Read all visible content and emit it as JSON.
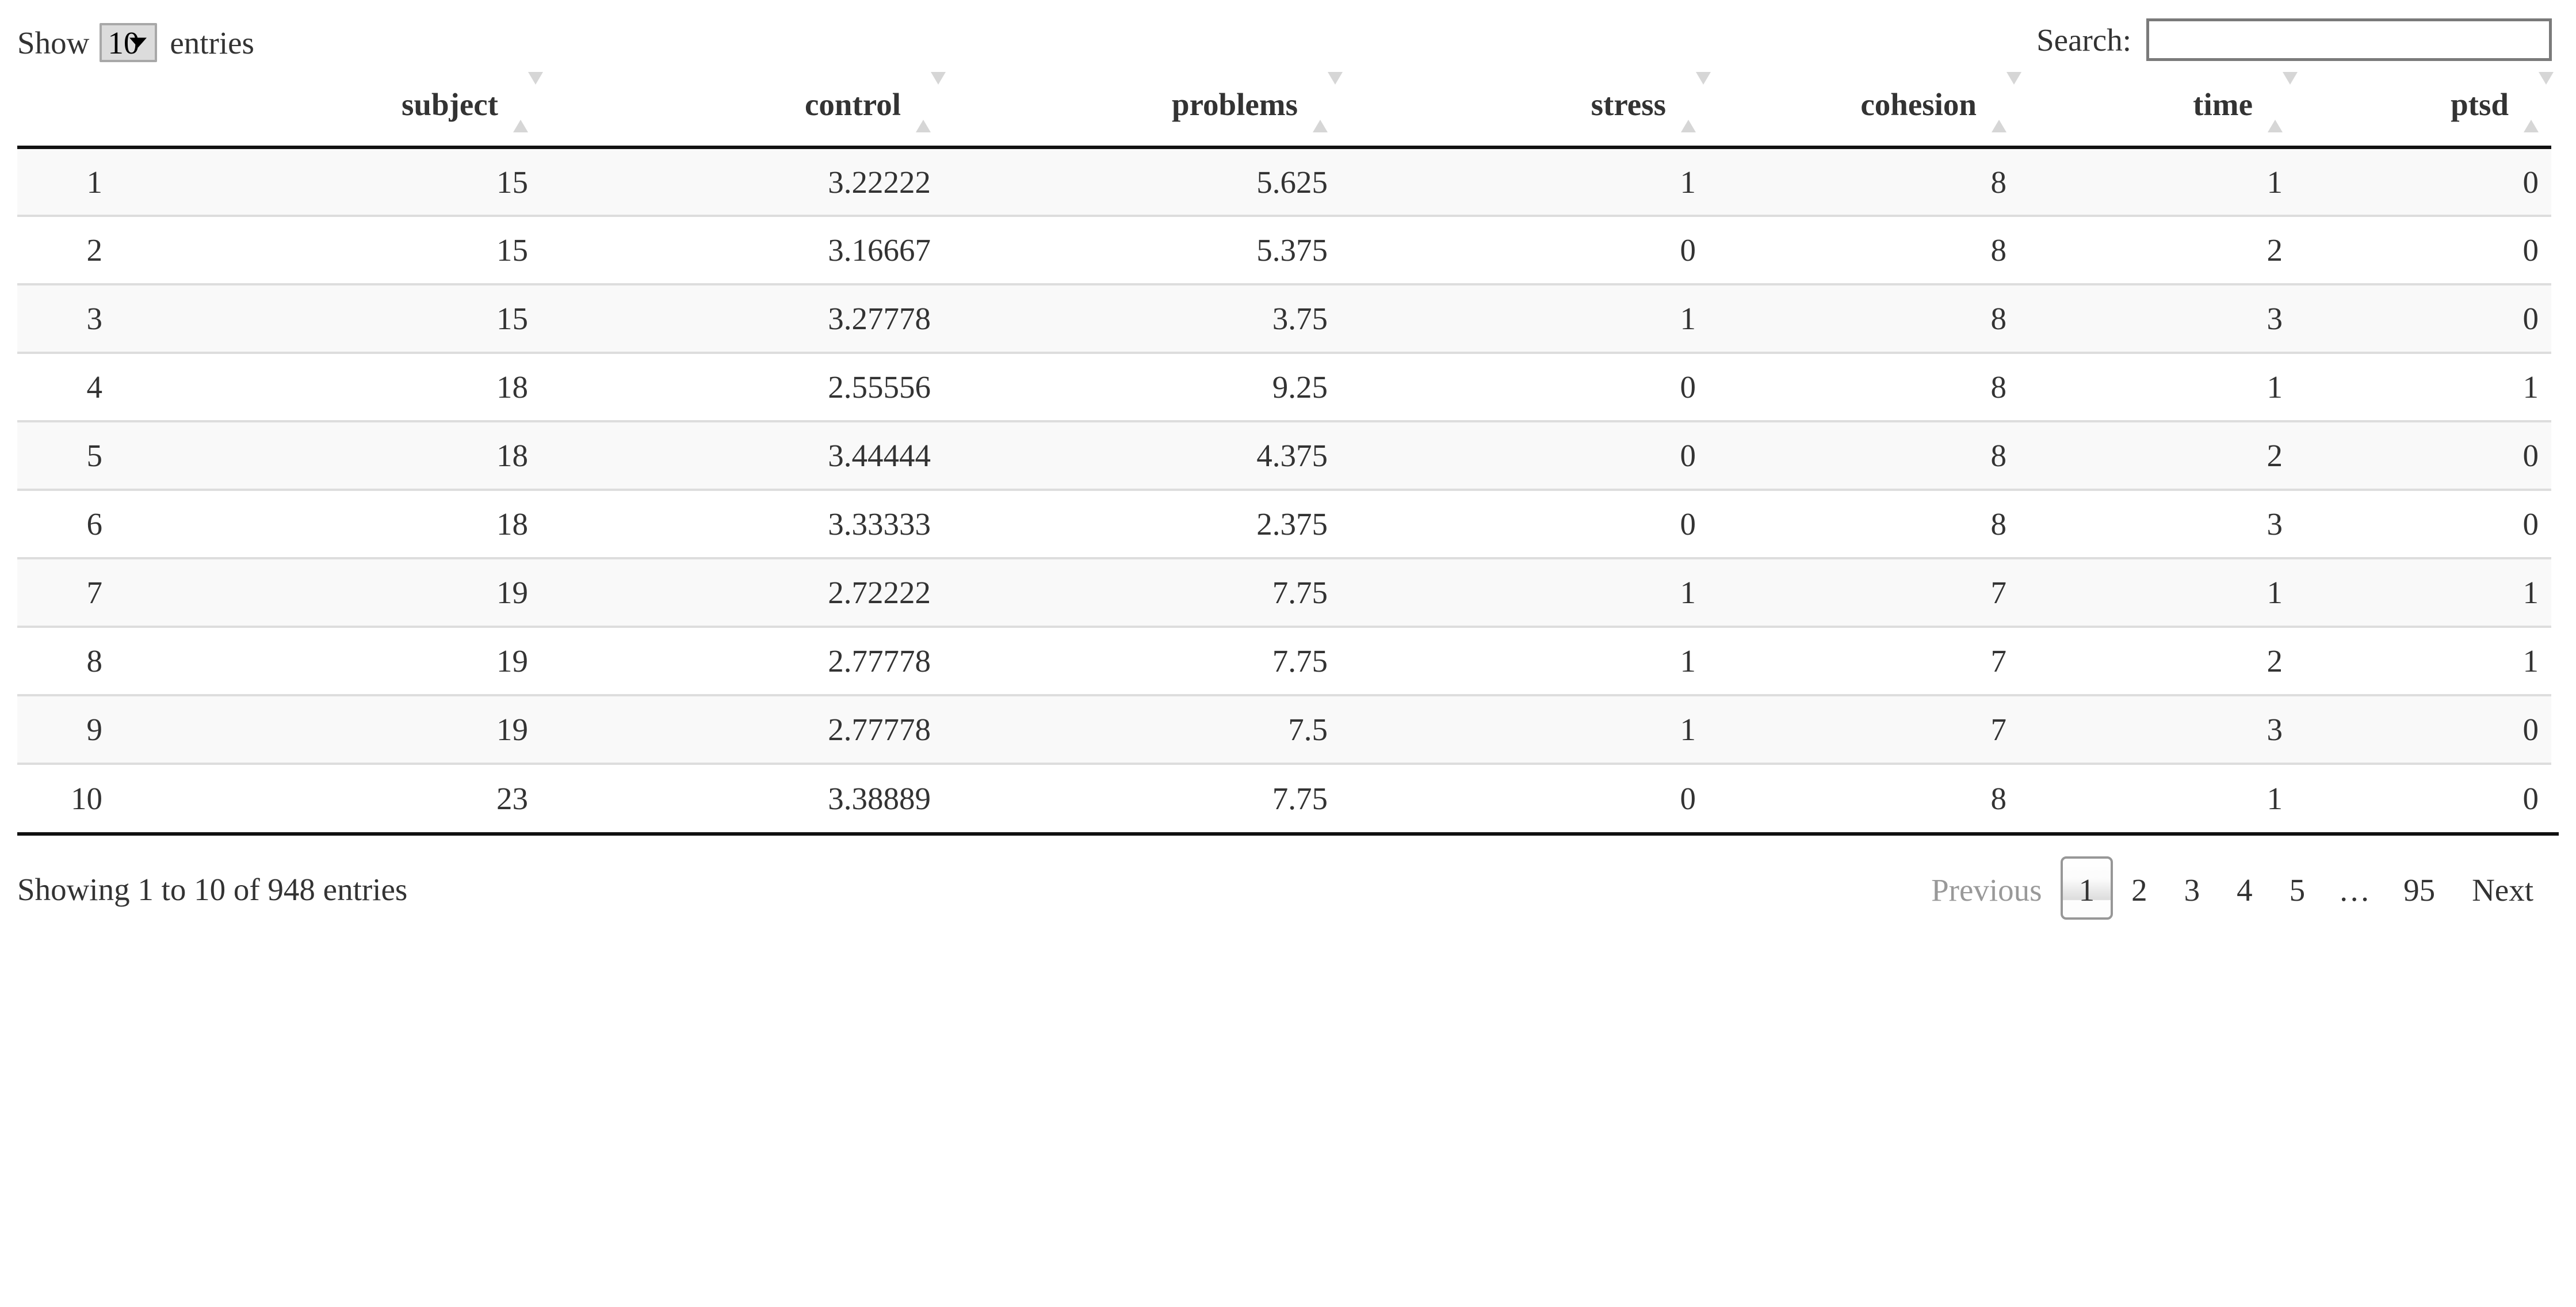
{
  "length_menu": {
    "label_before": "Show",
    "selected": "10",
    "label_after": "entries",
    "options": [
      "10",
      "25",
      "50",
      "100"
    ]
  },
  "search": {
    "label": "Search:",
    "value": "",
    "placeholder": ""
  },
  "table": {
    "columns": [
      {
        "key": "rownum",
        "label": "",
        "sortable": false
      },
      {
        "key": "subject",
        "label": "subject",
        "sortable": true
      },
      {
        "key": "control",
        "label": "control",
        "sortable": true
      },
      {
        "key": "problems",
        "label": "problems",
        "sortable": true
      },
      {
        "key": "stress",
        "label": "stress",
        "sortable": true
      },
      {
        "key": "cohesion",
        "label": "cohesion",
        "sortable": true
      },
      {
        "key": "time",
        "label": "time",
        "sortable": true
      },
      {
        "key": "ptsd",
        "label": "ptsd",
        "sortable": true
      }
    ],
    "rows": [
      {
        "rownum": "1",
        "subject": "15",
        "control": "3.22222",
        "problems": "5.625",
        "stress": "1",
        "cohesion": "8",
        "time": "1",
        "ptsd": "0"
      },
      {
        "rownum": "2",
        "subject": "15",
        "control": "3.16667",
        "problems": "5.375",
        "stress": "0",
        "cohesion": "8",
        "time": "2",
        "ptsd": "0"
      },
      {
        "rownum": "3",
        "subject": "15",
        "control": "3.27778",
        "problems": "3.75",
        "stress": "1",
        "cohesion": "8",
        "time": "3",
        "ptsd": "0"
      },
      {
        "rownum": "4",
        "subject": "18",
        "control": "2.55556",
        "problems": "9.25",
        "stress": "0",
        "cohesion": "8",
        "time": "1",
        "ptsd": "1"
      },
      {
        "rownum": "5",
        "subject": "18",
        "control": "3.44444",
        "problems": "4.375",
        "stress": "0",
        "cohesion": "8",
        "time": "2",
        "ptsd": "0"
      },
      {
        "rownum": "6",
        "subject": "18",
        "control": "3.33333",
        "problems": "2.375",
        "stress": "0",
        "cohesion": "8",
        "time": "3",
        "ptsd": "0"
      },
      {
        "rownum": "7",
        "subject": "19",
        "control": "2.72222",
        "problems": "7.75",
        "stress": "1",
        "cohesion": "7",
        "time": "1",
        "ptsd": "1"
      },
      {
        "rownum": "8",
        "subject": "19",
        "control": "2.77778",
        "problems": "7.75",
        "stress": "1",
        "cohesion": "7",
        "time": "2",
        "ptsd": "1"
      },
      {
        "rownum": "9",
        "subject": "19",
        "control": "2.77778",
        "problems": "7.5",
        "stress": "1",
        "cohesion": "7",
        "time": "3",
        "ptsd": "0"
      },
      {
        "rownum": "10",
        "subject": "23",
        "control": "3.38889",
        "problems": "7.75",
        "stress": "0",
        "cohesion": "8",
        "time": "1",
        "ptsd": "0"
      }
    ]
  },
  "footer": {
    "info": "Showing 1 to 10 of 948 entries",
    "pagination": {
      "previous": "Previous",
      "next": "Next",
      "ellipsis": "…",
      "pages": [
        "1",
        "2",
        "3",
        "4",
        "5"
      ],
      "last_page": "95",
      "current": "1"
    }
  },
  "colors": {
    "text": "#333333",
    "header_border": "#111111",
    "row_stripe": "#f9f9f9",
    "row_divider": "#dddddd",
    "sort_arrow": "#d6d6d6",
    "muted_text": "#999999"
  }
}
